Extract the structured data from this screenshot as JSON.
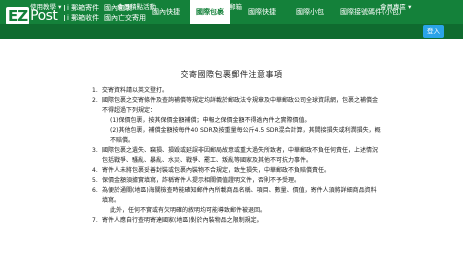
{
  "logo": {
    "mark": "EZ",
    "text": "Post"
  },
  "nav_groups": [
    {
      "line1": "i 郵箱寄件",
      "line2": "i 郵箱收件"
    },
    {
      "line1": "國內包裹",
      "line2": "國內亡交寄用"
    }
  ],
  "nav_items": [
    "國內快捷",
    "國際包裹",
    "國際快捷",
    "國際小包",
    "國際接號碼件(小包)"
  ],
  "nav_active": 1,
  "sub_items": [
    "使用教學",
    "會員積點活動",
    "郵站 i 郵箱"
  ],
  "sub_right": "會員專區",
  "login": "登入",
  "content_title": "交寄國際包裹郵件注意事項",
  "notes": [
    {
      "num": "1.",
      "text": "交寄資料請以英文登打。"
    },
    {
      "num": "2.",
      "text": "國際包裹之交寄條件及查詢補償等規定均詳載於郵政法令規章及中華郵政公司全球資訊網，包裹之補償金不得超過下列規定："
    },
    {
      "num": "",
      "text": "(1)保價包裹，按其保價金額補償；申報之保價金額不得逾內件之實際價值。",
      "sub": true
    },
    {
      "num": "",
      "text": "(2)其他包裹，補償金額按每件40 SDR及按重量每公斤4.5 SDR混合計算，其間接損失或利潤損失，概不賠償。",
      "sub": true
    },
    {
      "num": "3.",
      "text": "國際包裹之遺失、竊損、損毀或延誤非因郵局故意或重大過失所致者，中華郵政不負任何責任，上述情況包括戰爭、騷亂、暴亂、水災、戰爭、罷工、叛亂等國家及其他不可抗力事件。"
    },
    {
      "num": "4.",
      "text": "寄件人未將包裹妥善封裝或包裹內裝物不合規定，致生損失，中華郵政不負賠償責任。"
    },
    {
      "num": "5.",
      "text": "保價金額須據實填寫，詐稱寄件人提示相關價值證明文件，否則不予受理。"
    },
    {
      "num": "6.",
      "text": "為便於通關(地區)海關檢查時能確知郵件內所載商品名稱、項目、數量、價值，寄件人須將詳細商品資料填寫。"
    },
    {
      "num": "",
      "text": "此外，任何不實或有欠明確的敘明均可能導致郵件被退回。",
      "sub": true
    },
    {
      "num": "7.",
      "text": "寄件人應自行查明寄達國家(地區)對於內裝物品之限制規定。"
    }
  ]
}
